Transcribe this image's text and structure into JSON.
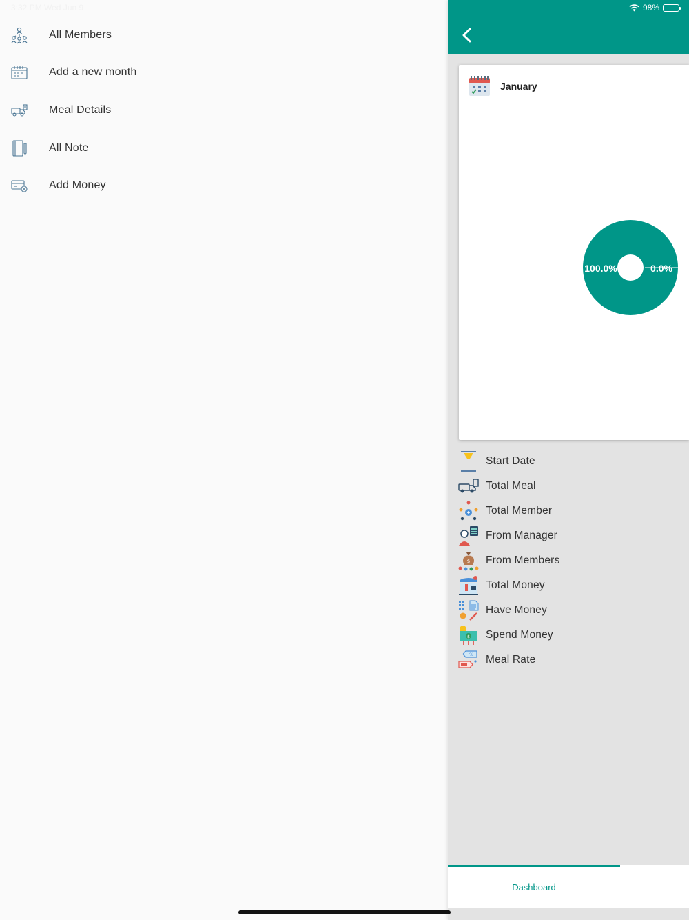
{
  "status_bar": {
    "left_text": "3:32 PM   Wed Jun 9",
    "battery_text": "98%",
    "battery_level": 0.98
  },
  "drawer": {
    "items": [
      {
        "label": "All Members",
        "icon": "members-icon"
      },
      {
        "label": "Add a new month",
        "icon": "calendar-icon"
      },
      {
        "label": "Meal Details",
        "icon": "meal-truck-icon"
      },
      {
        "label": "All Note",
        "icon": "notebook-icon"
      },
      {
        "label": "Add Money",
        "icon": "add-money-icon"
      }
    ]
  },
  "main": {
    "back_icon": "chevron-left-icon",
    "card": {
      "month": "January",
      "icon": "calendar-icon"
    },
    "stats": [
      {
        "label": "Start Date",
        "icon": "hourglass-icon"
      },
      {
        "label": "Total Meal",
        "icon": "meal-truck-icon"
      },
      {
        "label": "Total Member",
        "icon": "team-icon"
      },
      {
        "label": "From Manager",
        "icon": "manager-icon"
      },
      {
        "label": "From Members",
        "icon": "money-bag-icon"
      },
      {
        "label": "Total Money",
        "icon": "cash-register-icon"
      },
      {
        "label": "Have Money",
        "icon": "calculator-icon"
      },
      {
        "label": "Spend Money",
        "icon": "spend-money-icon"
      },
      {
        "label": "Meal Rate",
        "icon": "price-tag-icon"
      }
    ],
    "bottom_nav": {
      "tabs": [
        {
          "label": "Dashboard"
        }
      ]
    }
  },
  "colors": {
    "primary": "#009688",
    "panel_bg": "#e3e3e3",
    "drawer_bg": "#fafafa"
  },
  "chart_data": {
    "type": "pie",
    "categories": [
      "",
      ""
    ],
    "values": [
      100.0,
      0.0
    ],
    "labels": [
      "100.0%",
      "0.0%"
    ],
    "colors": [
      "#009688",
      "#009688"
    ],
    "donut_hole": true
  }
}
